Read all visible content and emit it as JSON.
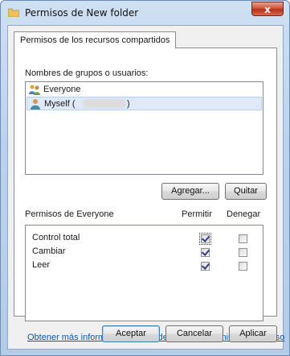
{
  "window": {
    "title": "Permisos de New folder",
    "close_label": "x"
  },
  "tab": {
    "label": "Permisos de los recursos compartidos"
  },
  "users": {
    "label": "Nombres de grupos o usuarios:",
    "items": [
      {
        "name": "Everyone",
        "icon": "group-users-icon",
        "selected": false
      },
      {
        "name": "Myself (",
        "suffix": ")",
        "icon": "user-icon",
        "selected": true
      }
    ],
    "add_button": "Agregar...",
    "remove_button": "Quitar"
  },
  "permissions": {
    "title": "Permisos de Everyone",
    "col_allow": "Permitir",
    "col_deny": "Denegar",
    "rows": [
      {
        "name": "Control total",
        "allow": true,
        "deny": false
      },
      {
        "name": "Cambiar",
        "allow": true,
        "deny": false
      },
      {
        "name": "Leer",
        "allow": true,
        "deny": false
      }
    ]
  },
  "link": {
    "text": "Obtener más información acerca de control y permisos de acceso"
  },
  "footer": {
    "ok": "Aceptar",
    "cancel": "Cancelar",
    "apply": "Aplicar"
  },
  "colors": {
    "title_gradient": "#bcd2ec",
    "close_red": "#c8442b",
    "link_blue": "#0a56b8",
    "selection": "#dfe9f8"
  }
}
